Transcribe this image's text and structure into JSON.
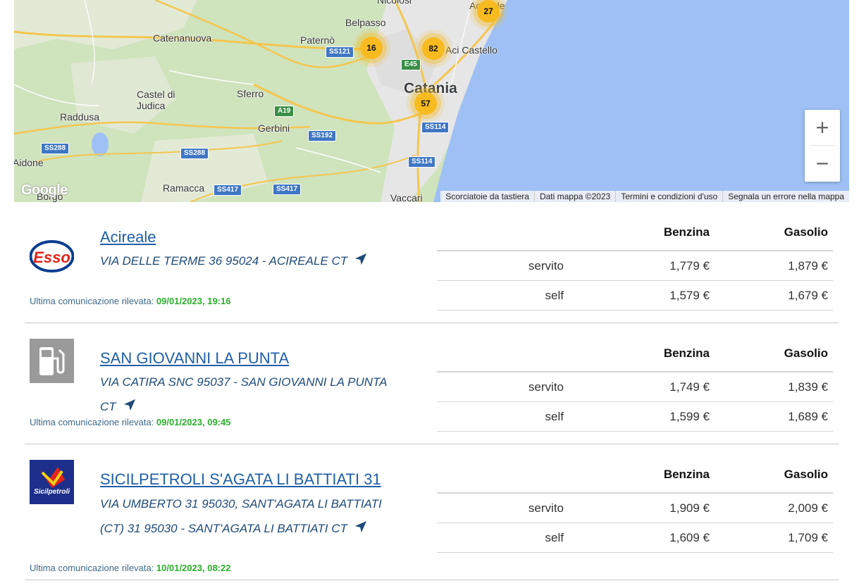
{
  "map": {
    "places": {
      "nicolosi": "Nicolosi",
      "belpasso": "Belpasso",
      "catenanuova": "Catenanuova",
      "paterno": "Paternò",
      "aci_castello": "Aci Castello",
      "acireale_partial": "Acireale",
      "catania": "Catania",
      "castel_di_judica": "Castel di\nJudica",
      "sferro": "Sferro",
      "raddusa": "Raddusa",
      "gerbini": "Gerbini",
      "aidone": "Aidone",
      "ramacca": "Ramacca",
      "borgo": "Borgo",
      "vaccari": "Vaccari"
    },
    "roads": {
      "ss121": "SS121",
      "e45": "E45",
      "a19": "A19",
      "ss114_a": "SS114",
      "ss114_b": "SS114",
      "ss192": "SS192",
      "ss288_a": "SS288",
      "ss288_b": "SS288",
      "ss417_a": "SS417",
      "ss417_b": "SS417"
    },
    "clusters": {
      "c16": "16",
      "c82": "82",
      "c57": "57",
      "c27": "27"
    },
    "zoom_in": "+",
    "zoom_out": "−",
    "google_logo": "Google",
    "attribution": {
      "shortcuts": "Scorciatoie da tastiera",
      "map_data": "Dati mappa ©2023",
      "terms": "Termini e condizioni d'uso",
      "report": "Segnala un errore nella mappa"
    }
  },
  "table_headers": {
    "benzina": "Benzina",
    "gasolio": "Gasolio"
  },
  "last_comm_label": "Ultima comunicazione rilevata:",
  "stations": [
    {
      "name": "Acireale",
      "logo": "esso-logo",
      "address": "VIA DELLE TERME 36 95024 - ACIREALE CT",
      "last_comm": "09/01/2023, 19:16",
      "rows": [
        {
          "type": "servito",
          "benzina": "1,779 €",
          "gasolio": "1,879 €"
        },
        {
          "type": "self",
          "benzina": "1,579 €",
          "gasolio": "1,679 €"
        }
      ]
    },
    {
      "name": "SAN GIOVANNI LA PUNTA",
      "logo": "fuel-pump-icon",
      "address": "VIA CATIRA SNC 95037 - SAN GIOVANNI LA PUNTA CT",
      "last_comm": "09/01/2023, 09:45",
      "rows": [
        {
          "type": "servito",
          "benzina": "1,749 €",
          "gasolio": "1,839 €"
        },
        {
          "type": "self",
          "benzina": "1,599 €",
          "gasolio": "1,689 €"
        }
      ]
    },
    {
      "name": "SICILPETROLI S'AGATA LI BATTIATI 31",
      "logo": "sicilpetroli-logo",
      "address": "VIA UMBERTO 31 95030, SANT'AGATA LI BATTIATI (CT) 31 95030 - SANT'AGATA LI BATTIATI CT",
      "last_comm": "10/01/2023, 08:22",
      "rows": [
        {
          "type": "servito",
          "benzina": "1,909 €",
          "gasolio": "2,009 €"
        },
        {
          "type": "self",
          "benzina": "1,609 €",
          "gasolio": "1,709 €"
        }
      ]
    }
  ],
  "colors": {
    "link": "#1f5fa8",
    "timestamp": "#2ab02a",
    "sea": "#9ec0f5",
    "land": "#cfe3bd",
    "cluster": "#f7bb1f"
  }
}
